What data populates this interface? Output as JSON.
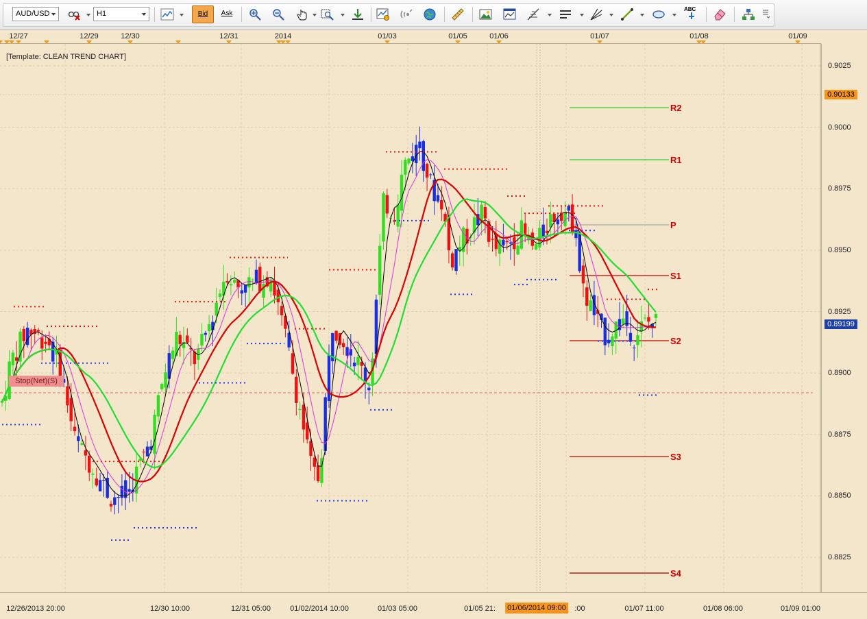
{
  "toolbar": {
    "symbol": "AUD/USD",
    "timeframe": "H1",
    "bid_label": "Bid",
    "ask_label": "Ask",
    "abc_label": "ABC"
  },
  "chart": {
    "template_label": "[Template: CLEAN TREND CHART]",
    "stop_label": "Stop(Net)(S)",
    "top_time_labels": [
      "12/27",
      "12/29",
      "12/30",
      "12/31",
      "2014",
      "01/03",
      "01/05",
      "01/06",
      "01/07",
      "01/08",
      "01/09"
    ],
    "bottom_time_labels": [
      "12/26/2013 20:00",
      "12/30 10:00",
      "12/31 05:00",
      "01/02/2014 10:00",
      "01/03 05:00",
      "01/05 21:",
      ":00",
      "01/07 11:00",
      "01/08 06:00",
      "01/09 01:00"
    ],
    "crosshair_time": "01/06/2014 09:00",
    "price_labels": [
      "0.9025",
      "0.9000",
      "0.8975",
      "0.8950",
      "0.8925",
      "0.8900",
      "0.8875",
      "0.8850",
      "0.8825"
    ],
    "price_tags": [
      {
        "value": "0.90133",
        "bg": "#f7941d",
        "fg": "#000000"
      },
      {
        "value": "0.89199",
        "bg": "#1c3fa8",
        "fg": "#ffffff"
      }
    ],
    "pivot_labels": [
      "R2",
      "R1",
      "P",
      "S1",
      "S2",
      "S3",
      "S4"
    ],
    "colors": {
      "background": "#f3e6cb",
      "bull_candle": "#33dd22",
      "bear_candle": "#ee1111",
      "blue_candle": "#1a2fe0",
      "sma_red": "#dd0000",
      "sma_green": "#22dd33",
      "ma_magenta": "#dd33dd",
      "ma_black": "#000000",
      "pivot_resistance": "#33cc33",
      "pivot_support": "#cc0000"
    }
  }
}
